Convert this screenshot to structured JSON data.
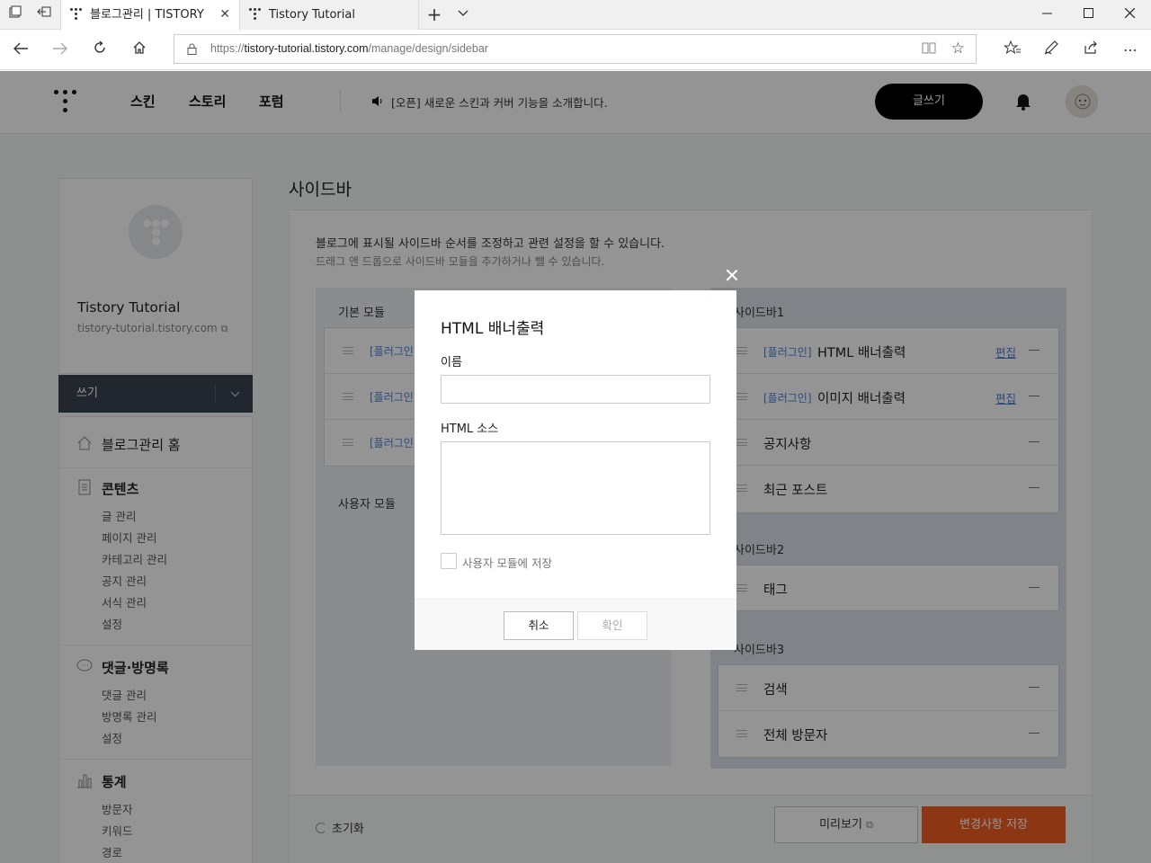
{
  "browser": {
    "tabs": [
      {
        "label": "블로그관리 | TISTORY",
        "active": true
      },
      {
        "label": "Tistory Tutorial",
        "active": false
      }
    ],
    "url_prefix": "https://",
    "url_host": "tistory-tutorial.tistory.com",
    "url_path": "/manage/design/sidebar",
    "icons": {
      "tab_manager": "tab-manager-icon",
      "set_aside": "set-aside-tabs-icon",
      "new_tab": "+",
      "tab_list": "chevron-down-icon",
      "minimize": "minimize-icon",
      "maximize": "maximize-icon",
      "close": "close-icon",
      "back": "back-arrow-icon",
      "forward": "forward-arrow-icon",
      "refresh": "refresh-icon",
      "home": "home-icon",
      "favorites": "favorites-icon",
      "notes": "pen-icon",
      "share": "share-icon",
      "more": "more-icon"
    }
  },
  "header": {
    "nav": [
      "스킨",
      "스토리",
      "포럼"
    ],
    "notice": "[오픈] 새로운 스킨과 커버 기능을 소개합니다.",
    "write_button": "글쓰기"
  },
  "sidebar": {
    "blog_name": "Tistory Tutorial",
    "blog_url": "tistory-tutorial.tistory.com",
    "write_label": "쓰기",
    "home": "블로그관리 홈",
    "sections": [
      {
        "title": "콘텐츠",
        "items": [
          "글 관리",
          "페이지 관리",
          "카테고리 관리",
          "공지 관리",
          "서식 관리",
          "설정"
        ]
      },
      {
        "title": "댓글·방명록",
        "items": [
          "댓글 관리",
          "방명록 관리",
          "설정"
        ]
      },
      {
        "title": "통계",
        "items": [
          "방문자",
          "키워드",
          "경로"
        ]
      }
    ]
  },
  "main": {
    "title": "사이드바",
    "desc": "블로그에 표시될 사이드바 순서를 조정하고 관련 설정을 할 수 있습니다.",
    "sub_desc": "드래그 앤 드롭으로 사이드바 모듈을 추가하거나 뺄 수 있습니다.",
    "basic_modules_title": "기본 모듈",
    "basic_modules": [
      "[플러그인",
      "[플러그인",
      "[플러그인"
    ],
    "user_modules_title": "사용자 모듈",
    "right_sections": [
      {
        "title": "사이드바1",
        "items": [
          {
            "tag": "[플러그인]",
            "label": "HTML 배너출력",
            "edit": "편집"
          },
          {
            "tag": "[플러그인]",
            "label": "이미지 배너출력",
            "edit": "편집"
          },
          {
            "tag": "",
            "label": "공지사항",
            "edit": ""
          },
          {
            "tag": "",
            "label": "최근 포스트",
            "edit": ""
          }
        ]
      },
      {
        "title": "사이드바2",
        "items": [
          {
            "tag": "",
            "label": "태그",
            "edit": ""
          }
        ]
      },
      {
        "title": "사이드바3",
        "items": [
          {
            "tag": "",
            "label": "검색",
            "edit": ""
          },
          {
            "tag": "",
            "label": "전체 방문자",
            "edit": ""
          }
        ]
      }
    ],
    "reset_label": "초기화",
    "preview_label": "미리보기",
    "save_label": "변경사항 저장"
  },
  "modal": {
    "title": "HTML 배너출력",
    "name_label": "이름",
    "name_value": "",
    "source_label": "HTML 소스",
    "source_value": "",
    "save_to_user_module_label": "사용자 모듈에 저장",
    "save_to_user_module_checked": false,
    "cancel_label": "취소",
    "confirm_label": "확인"
  },
  "colors": {
    "accent": "#f25d22",
    "link": "#4a7fd8",
    "dark": "#3b4350"
  }
}
